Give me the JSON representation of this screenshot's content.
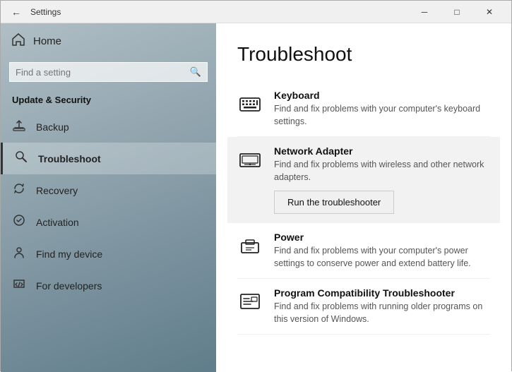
{
  "titleBar": {
    "title": "Settings",
    "backIcon": "←",
    "minimizeIcon": "─",
    "maximizeIcon": "□",
    "closeIcon": "✕"
  },
  "sidebar": {
    "homeLabel": "Home",
    "searchPlaceholder": "Find a setting",
    "sectionTitle": "Update & Security",
    "items": [
      {
        "id": "backup",
        "label": "Backup",
        "icon": "backup"
      },
      {
        "id": "troubleshoot",
        "label": "Troubleshoot",
        "icon": "wrench",
        "active": true
      },
      {
        "id": "recovery",
        "label": "Recovery",
        "icon": "recovery"
      },
      {
        "id": "activation",
        "label": "Activation",
        "icon": "activation"
      },
      {
        "id": "findmydevice",
        "label": "Find my device",
        "icon": "person"
      },
      {
        "id": "fordevelopers",
        "label": "For developers",
        "icon": "code"
      }
    ]
  },
  "content": {
    "title": "Troubleshoot",
    "items": [
      {
        "id": "keyboard",
        "title": "Keyboard",
        "desc": "Find and fix problems with your computer's keyboard settings.",
        "highlighted": false
      },
      {
        "id": "network",
        "title": "Network Adapter",
        "desc": "Find and fix problems with wireless and other network adapters.",
        "highlighted": true,
        "buttonLabel": "Run the troubleshooter"
      },
      {
        "id": "power",
        "title": "Power",
        "desc": "Find and fix problems with your computer's power settings to conserve power and extend battery life.",
        "highlighted": false
      },
      {
        "id": "compat",
        "title": "Program Compatibility Troubleshooter",
        "desc": "Find and fix problems with running older programs on this version of Windows.",
        "highlighted": false
      }
    ]
  }
}
